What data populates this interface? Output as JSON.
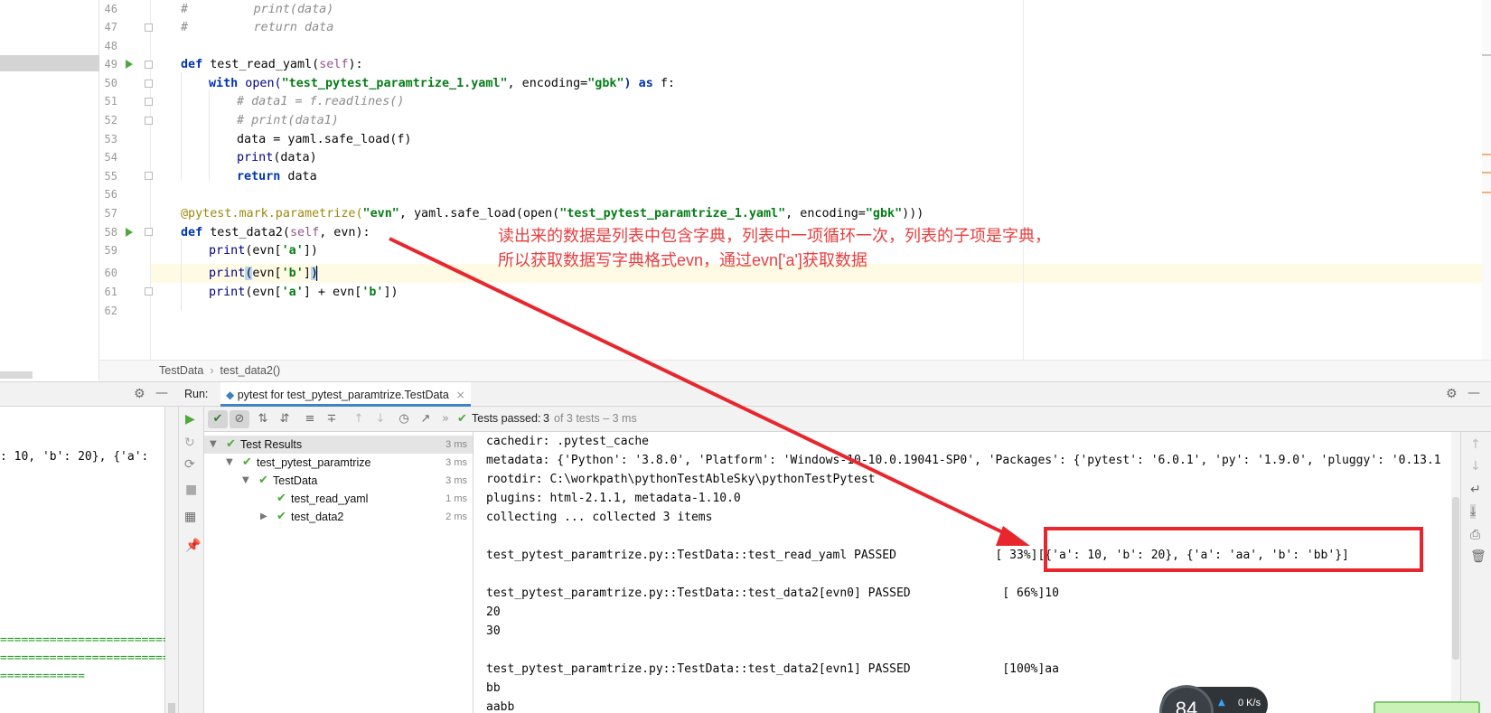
{
  "editor": {
    "lines": [
      {
        "num": "46",
        "text": "#         print(data)"
      },
      {
        "num": "47",
        "text": "#         return data"
      },
      {
        "num": "48",
        "text": ""
      },
      {
        "num": "49",
        "text": "def test_read_yaml(self):"
      },
      {
        "num": "50",
        "text": "with open(\"test_pytest_paramtrize_1.yaml\", encoding=\"gbk\") as f:"
      },
      {
        "num": "51",
        "text": "# data1 = f.readlines()"
      },
      {
        "num": "52",
        "text": "# print(data1)"
      },
      {
        "num": "53",
        "text": "data = yaml.safe_load(f)"
      },
      {
        "num": "54",
        "text": "print(data)"
      },
      {
        "num": "55",
        "text": "return data"
      },
      {
        "num": "56",
        "text": ""
      },
      {
        "num": "57",
        "text": "@pytest.mark.parametrize(\"evn\", yaml.safe_load(open(\"test_pytest_paramtrize_1.yaml\", encoding=\"gbk\")))"
      },
      {
        "num": "58",
        "text": "def test_data2(self, evn):"
      },
      {
        "num": "59",
        "text": "print(evn['a'])"
      },
      {
        "num": "60",
        "text": "print(evn['b'])"
      },
      {
        "num": "61",
        "text": "print(evn['a'] + evn['b'])"
      },
      {
        "num": "62",
        "text": ""
      }
    ],
    "code_parts": {
      "l46": "#         print(data)",
      "l47": "#         return data",
      "l49_kw": "def",
      "l49_fn": " test_read_yaml(",
      "l49_self": "self",
      "l49_end": "):",
      "l50_with": "with",
      "l50_open": " open(",
      "l50_file": "\"test_pytest_paramtrize_1.yaml\"",
      "l50_enc": ", encoding=",
      "l50_gbk": "\"gbk\"",
      "l50_as": ") as",
      "l50_f": " f:",
      "l51": "# data1 = f.readlines()",
      "l52": "# print(data1)",
      "l53": "data = yaml.safe_load(f)",
      "l54_print": "print",
      "l54_rest": "(data)",
      "l55_ret": "return",
      "l55_rest": " data",
      "l57_deco": "@pytest.mark.parametrize(",
      "l57_evn": "\"evn\"",
      "l57_mid": ", yaml.safe_load(open(",
      "l57_file": "\"test_pytest_paramtrize_1.yaml\"",
      "l57_enc": ", encoding=",
      "l57_gbk": "\"gbk\"",
      "l57_end": ")))",
      "l58_kw": "def",
      "l58_fn": " test_data2(",
      "l58_self": "self",
      "l58_end": ", evn):",
      "l59_print": "print",
      "l59_a": "(evn[",
      "l59_key": "'a'",
      "l59_end": "])",
      "l60_print": "print",
      "l60_open": "(",
      "l60_mid": "evn[",
      "l60_key": "'b'",
      "l60_close1": "]",
      "l60_close2": ")",
      "l61_print": "print",
      "l61_a": "(evn[",
      "l61_ka": "'a'",
      "l61_mid": "] + evn[",
      "l61_kb": "'b'",
      "l61_end": "])"
    }
  },
  "annotation": {
    "line1": "读出来的数据是列表中包含字典，列表中一项循环一次，列表的子项是字典，",
    "line2": "所以获取数据写字典格式evn，通过evn['a']获取数据"
  },
  "breadcrumb": {
    "class_name": "TestData",
    "separator": "›",
    "method_name": "test_data2()"
  },
  "run_panel": {
    "run_label": "Run:",
    "tab_label": "pytest for test_pytest_paramtrize.TestData",
    "tests_passed_label": "Tests passed:",
    "tests_passed_count": "3",
    "tests_passed_detail": "of 3 tests – 3 ms"
  },
  "tree": [
    {
      "label": "Test Results",
      "time": "3 ms"
    },
    {
      "label": "test_pytest_paramtrize",
      "time": "3 ms"
    },
    {
      "label": "TestData",
      "time": "3 ms"
    },
    {
      "label": "test_read_yaml",
      "time": "1 ms"
    },
    {
      "label": "test_data2",
      "time": "2 ms"
    }
  ],
  "console": {
    "lines": [
      "cachedir: .pytest_cache",
      "metadata: {'Python': '3.8.0', 'Platform': 'Windows-10-10.0.19041-SP0', 'Packages': {'pytest': '6.0.1', 'py': '1.9.0', 'pluggy': '0.13.1",
      "rootdir: C:\\workpath\\pythonTestAbleSky\\pythonTestPytest",
      "plugins: html-2.1.1, metadata-1.10.0",
      "collecting ... collected 3 items",
      "",
      "test_pytest_paramtrize.py::TestData::test_read_yaml PASSED              [ 33%][{'a': 10, 'b': 20}, {'a': 'aa', 'b': 'bb'}]",
      "",
      "test_pytest_paramtrize.py::TestData::test_data2[evn0] PASSED             [ 66%]10",
      "20",
      "30",
      "",
      "test_pytest_paramtrize.py::TestData::test_data2[evn1] PASSED             [100%]aa",
      "bb",
      "aabb"
    ]
  },
  "left_console": {
    "line": ": 10, 'b': 20}, {'a':",
    "sep1": "=============================",
    "sep2": "=============================",
    "sep3": "============"
  },
  "widgets": {
    "gauge_value": "84",
    "speed": "0 K/s"
  },
  "colors": {
    "accent": "#4083c9",
    "pass_green": "#4caa3a",
    "annotation_red": "#e83e3e",
    "highlight_red": "#e8262d"
  }
}
